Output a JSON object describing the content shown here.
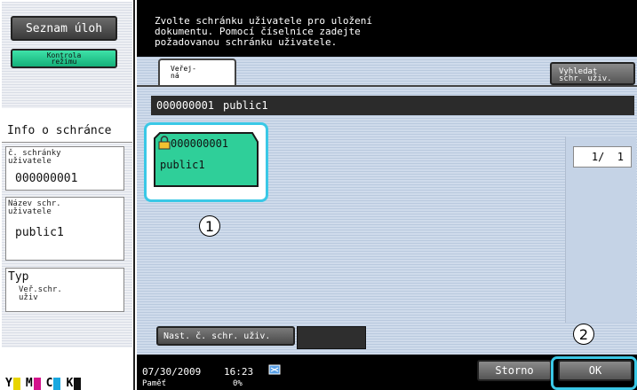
{
  "sidebar": {
    "job_list_label": "Seznam úloh",
    "mode_check_label": "Kontrola\nrežimu",
    "box_info_title": "Info o schránce",
    "user_box_no_label": "č. schránky\nuživatele",
    "user_box_no_value": "000000001",
    "user_box_name_label": "Název schr.\nuživatele",
    "user_box_name_value": "public1",
    "type_title": "Typ",
    "type_value": "Veř.schr.\nuživ",
    "toner": [
      {
        "name": "Y",
        "color": "#e8d400"
      },
      {
        "name": "M",
        "color": "#d4148c"
      },
      {
        "name": "C",
        "color": "#18a8e0"
      },
      {
        "name": "K",
        "color": "#111111"
      }
    ]
  },
  "header": {
    "instruction": "Zvolte schránku uživatele pro uložení\ndokumentu. Pomocí číselnice zadejte\npožadovanou schránku uživatele."
  },
  "tabs": {
    "public_label": "Veřej-\nná",
    "search_label": "Vyhledat\nschr. uživ."
  },
  "selected_bar": {
    "number": "000000001",
    "name": "public1"
  },
  "box_tile": {
    "number": "000000001",
    "name": "public1"
  },
  "pager": {
    "text": "1/  1"
  },
  "set_box_no": {
    "label": "Nast. č. schr. uživ."
  },
  "footer": {
    "date": "07/30/2009",
    "time": "16:23",
    "memory_label": "Paměť",
    "memory_value": "0%",
    "cancel_label": "Storno",
    "ok_label": "OK"
  },
  "callouts": {
    "one": "1",
    "two": "2"
  }
}
